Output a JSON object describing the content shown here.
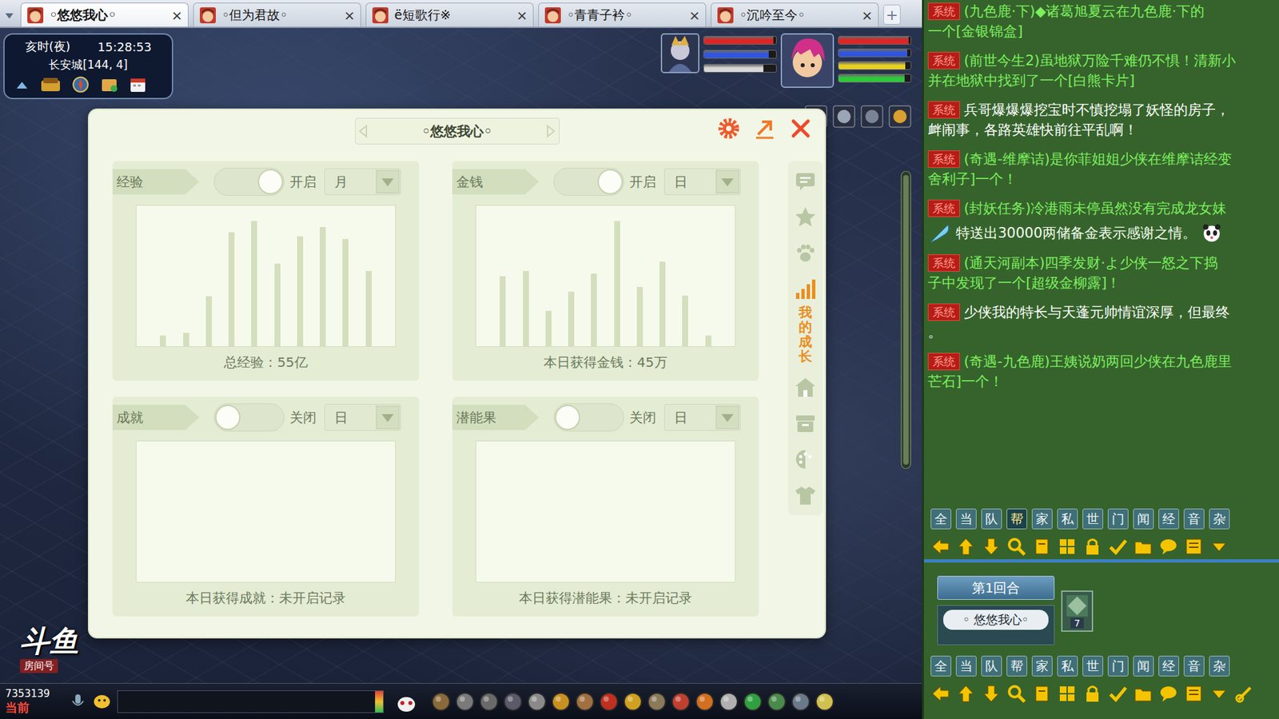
{
  "browser_tabs": {
    "items": [
      {
        "label": "◦悠悠我心◦",
        "close": "×",
        "selected": true
      },
      {
        "label": "◦但为君故◦",
        "close": "×",
        "selected": false
      },
      {
        "label": "ë短歌行※",
        "close": "×",
        "selected": false
      },
      {
        "label": "◦青青子衿◦",
        "close": "×",
        "selected": false
      },
      {
        "label": "◦沉吟至今◦",
        "close": "×",
        "selected": false
      }
    ],
    "new_tab": "+"
  },
  "hud": {
    "period": "亥时(夜)",
    "time": "15:28:53",
    "location": "长安城[144, 4]",
    "pet_bars": [
      {
        "level": 0.96,
        "color": "#e02424"
      },
      {
        "level": 0.9,
        "color": "#2f56e0"
      },
      {
        "level": 0.82,
        "color": "#d8d8d8"
      }
    ],
    "player_bars": [
      {
        "level": 0.97,
        "color": "#e02424"
      },
      {
        "level": 0.95,
        "color": "#2f56e0"
      },
      {
        "level": 0.93,
        "color": "#e8d020"
      },
      {
        "level": 0.92,
        "color": "#2fc83a"
      }
    ]
  },
  "dialog": {
    "title": "◦悠悠我心◦",
    "cards": [
      {
        "label": "经验",
        "on": true,
        "state_text": "开启",
        "period": "月",
        "values": [
          14,
          17,
          64,
          145,
          160,
          105,
          140,
          152,
          137,
          96
        ],
        "footer": "总经验：55亿"
      },
      {
        "label": "金钱",
        "on": true,
        "state_text": "开启",
        "period": "日",
        "values": [
          89,
          96,
          45,
          70,
          93,
          160,
          76,
          108,
          65,
          14
        ],
        "footer": "本日获得金钱：45万"
      },
      {
        "label": "成就",
        "on": false,
        "state_text": "关闭",
        "period": "日",
        "values": [],
        "footer": "本日获得成就：未开启记录"
      },
      {
        "label": "潜能果",
        "on": false,
        "state_text": "关闭",
        "period": "日",
        "values": [],
        "footer": "本日获得潜能果：未开启记录"
      }
    ],
    "sidebar": {
      "items": [
        {
          "selected": false
        },
        {
          "selected": false
        },
        {
          "selected": false
        },
        {
          "label": "我的成长",
          "selected": true
        },
        {
          "selected": false
        },
        {
          "selected": false
        },
        {
          "selected": false
        },
        {
          "selected": false
        }
      ]
    }
  },
  "overlay": {
    "logo": "斗鱼",
    "room_label": "房间号",
    "room_id": "7353139"
  },
  "chat_bar": {
    "channel": "当前"
  },
  "chat": {
    "messages": [
      {
        "tag": "系统",
        "lines": [
          "(九色鹿·下)◆诸葛旭夏云在九色鹿·下的",
          "一个[金银锦盒]"
        ],
        "color": "#7cf05e",
        "kind": "plain"
      },
      {
        "tag": "系统",
        "lines": [
          "(前世今生2)虽地狱万险千难仍不惧！清新小",
          "并在地狱中找到了一个[白熊卡片]"
        ],
        "color": "#7cf05e",
        "kind": "plain"
      },
      {
        "tag": "系统",
        "lines": [
          "兵哥爆爆爆挖宝时不慎挖塌了妖怪的房子，",
          "衅闹事，各路英雄快前往平乱啊！"
        ],
        "color": "#ffffff",
        "kind": "plain"
      },
      {
        "tag": "系统",
        "lines": [
          "(奇遇-维摩诘)是你菲姐姐少侠在维摩诘经变",
          "舍利子]一个！"
        ],
        "color": "#7cf05e",
        "kind": "plain"
      },
      {
        "tag": "系统",
        "lines": [
          "(封妖任务)冷港雨未停虽然没有完成龙女妹",
          "特送出30000两储备金表示感谢之情。"
        ],
        "color": "#7cf05e",
        "kind": "with-icons"
      },
      {
        "tag": "系统",
        "lines": [
          "(通天河副本)四季发财·よ少侠一怒之下捣",
          "子中发现了一个[超级金柳露]！"
        ],
        "color": "#7cf05e",
        "kind": "plain"
      },
      {
        "tag": "系统",
        "lines": [
          "少侠我的特长与天蓬元帅情谊深厚，但最终",
          "。"
        ],
        "color": "#ffffff",
        "kind": "plain"
      },
      {
        "tag": "系统",
        "lines": [
          "(奇遇-九色鹿)王姨说奶两回少侠在九色鹿里",
          "芒石]一个！"
        ],
        "color": "#7cf05e",
        "kind": "plain"
      }
    ],
    "channels_top": [
      {
        "label": "全",
        "selected": false
      },
      {
        "label": "当",
        "selected": false
      },
      {
        "label": "队",
        "selected": false
      },
      {
        "label": "帮",
        "selected": true
      },
      {
        "label": "家",
        "selected": false
      },
      {
        "label": "私",
        "selected": false
      },
      {
        "label": "世",
        "selected": false
      },
      {
        "label": "门",
        "selected": false
      },
      {
        "label": "闻",
        "selected": false
      },
      {
        "label": "经",
        "selected": false
      },
      {
        "label": "音",
        "selected": false
      },
      {
        "label": "杂",
        "selected": false
      }
    ],
    "combat": {
      "round": "第1回合",
      "name": "◦ 悠悠我心◦",
      "count": "7"
    },
    "channels_bottom": [
      {
        "label": "全",
        "selected": false
      },
      {
        "label": "当",
        "selected": false
      },
      {
        "label": "队",
        "selected": false
      },
      {
        "label": "帮",
        "selected": false
      },
      {
        "label": "家",
        "selected": false
      },
      {
        "label": "私",
        "selected": false
      },
      {
        "label": "世",
        "selected": false
      },
      {
        "label": "门",
        "selected": false
      },
      {
        "label": "闻",
        "selected": false
      },
      {
        "label": "经",
        "selected": false
      },
      {
        "label": "音",
        "selected": false
      },
      {
        "label": "杂",
        "selected": false
      }
    ]
  }
}
